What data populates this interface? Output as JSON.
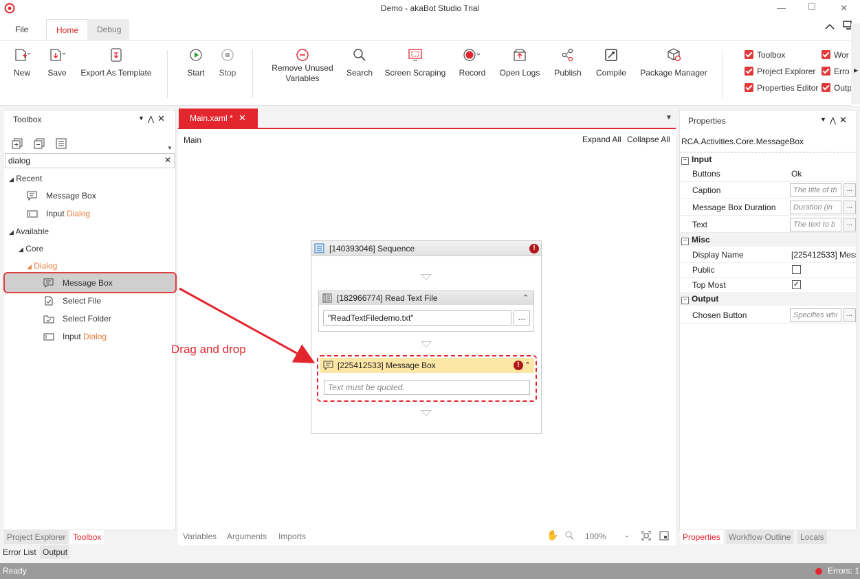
{
  "window": {
    "title": "Demo - akaBot Studio Trial"
  },
  "ribbon_tabs": [
    {
      "label": "File"
    },
    {
      "label": "Home"
    },
    {
      "label": "Debug"
    }
  ],
  "ribbon": {
    "new": "New",
    "save": "Save",
    "export_template": "Export As Template",
    "start": "Start",
    "stop": "Stop",
    "remove_unused_1": "Remove Unused",
    "remove_unused_2": "Variables",
    "search": "Search",
    "screen_scraping": "Screen Scraping",
    "record": "Record",
    "open_logs": "Open Logs",
    "publish": "Publish",
    "compile": "Compile",
    "package_manager": "Package Manager"
  },
  "view_checks": [
    "Toolbox",
    "Project Explorer",
    "Properties Editor",
    "Wor",
    "Erro",
    "Outp"
  ],
  "toolbox": {
    "title": "Toolbox",
    "search_value": "dialog",
    "recent": "Recent",
    "recent_items": [
      {
        "label": "Message Box",
        "hl": ""
      },
      {
        "label": "Input ",
        "hl": "Dialog"
      }
    ],
    "available": "Available",
    "core": "Core",
    "dialog": "Dialog",
    "dialog_items": [
      {
        "label": "Message Box",
        "hl": ""
      },
      {
        "label": "Select File",
        "hl": ""
      },
      {
        "label": "Select Folder",
        "hl": ""
      },
      {
        "label": "Input ",
        "hl": "Dialog"
      }
    ]
  },
  "left_tabs": [
    "Project Explorer",
    "Toolbox"
  ],
  "bottom_tabs": [
    "Error List",
    "Output"
  ],
  "designer": {
    "tab": "Main.xaml *",
    "breadcrumb": "Main",
    "expand_all": "Expand All",
    "collapse_all": "Collapse All",
    "sequence": "[140393046] Sequence",
    "read_text": "[182966774] Read Text File",
    "read_text_value": "\"ReadTextFiledemo.txt\"",
    "msgbox": "[225412533] Message Box",
    "msgbox_placeholder": "Text must be quoted.",
    "bottom": [
      "Variables",
      "Arguments",
      "Imports"
    ],
    "zoom": "100%"
  },
  "annotation": {
    "text": "Drag and drop"
  },
  "properties": {
    "title": "Properties",
    "type": "RCA.Activities.Core.MessageBox",
    "input": "Input",
    "buttons_label": "Buttons",
    "buttons_value": "Ok",
    "caption_label": "Caption",
    "caption_ph": "The title of th",
    "duration_label": "Message Box Duration",
    "duration_ph": "Duration (in",
    "text_label": "Text",
    "text_ph": "The text to b",
    "misc": "Misc",
    "display_label": "Display Name",
    "display_value": "[225412533] Mess",
    "public_label": "Public",
    "public_checked": false,
    "top_most_label": "Top Most",
    "top_most_checked": true,
    "output": "Output",
    "chosen_label": "Chosen Button",
    "chosen_ph": "Specifies whi"
  },
  "right_tabs": [
    "Properties",
    "Workflow Outline",
    "Locals"
  ],
  "status": {
    "ready": "Ready",
    "errors": "Errors: 1"
  },
  "colors": {
    "accent": "#e3262e",
    "highlight": "#e87d3e",
    "selected_activity": "#fde7a6"
  }
}
